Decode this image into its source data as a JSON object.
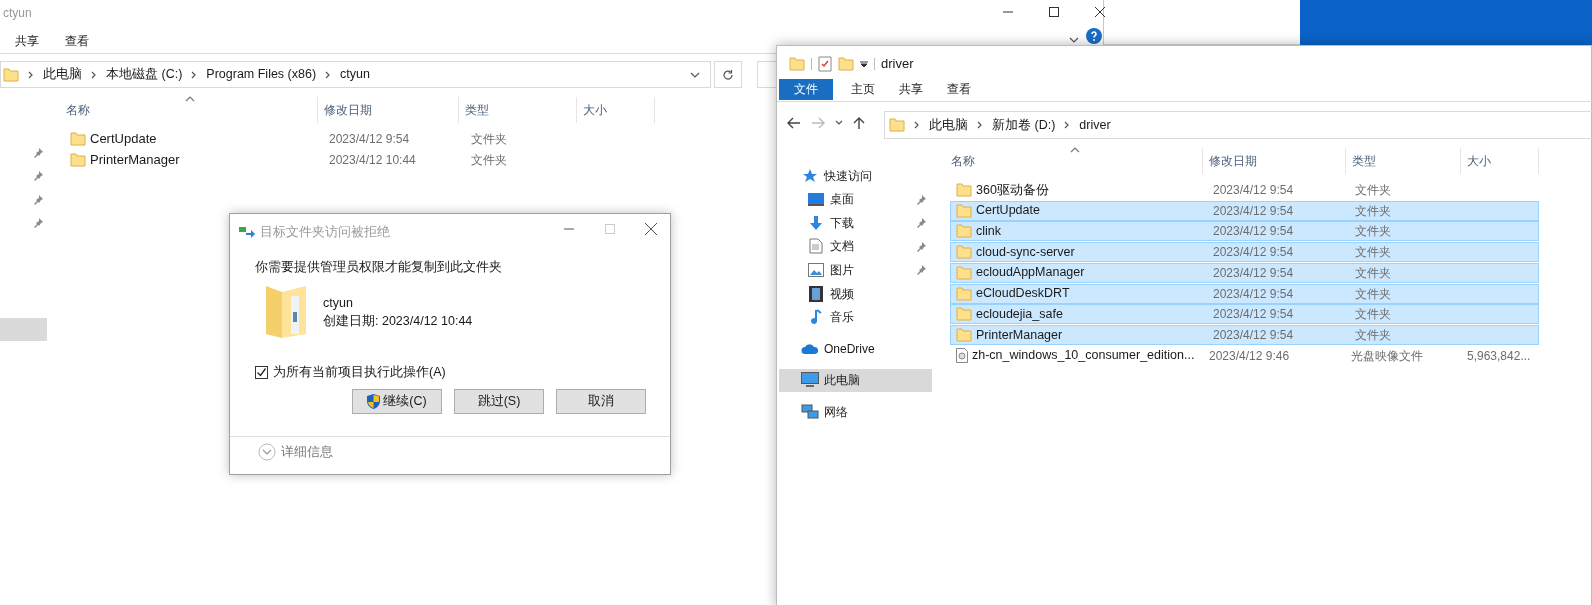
{
  "left_window": {
    "title": "ctyun",
    "ribbon_tabs": [
      {
        "label": "共享",
        "selected": false
      },
      {
        "label": "查看",
        "selected": false
      }
    ],
    "breadcrumb": [
      "此电脑",
      "本地磁盘 (C:)",
      "Program Files (x86)",
      "ctyun"
    ],
    "columns": [
      "名称",
      "修改日期",
      "类型",
      "大小"
    ],
    "rows": [
      {
        "name": "CertUpdate",
        "modified": "2023/4/12 9:54",
        "type": "文件夹"
      },
      {
        "name": "PrinterManager",
        "modified": "2023/4/12 10:44",
        "type": "文件夹"
      }
    ]
  },
  "dialog": {
    "title": "目标文件夹访问被拒绝",
    "message": "你需要提供管理员权限才能复制到此文件夹",
    "item_name": "ctyun",
    "item_detail": "创建日期: 2023/4/12 10:44",
    "apply_to_all": {
      "label": "为所有当前项目执行此操作(A)",
      "checked": true
    },
    "buttons": [
      {
        "label": "继续(C)",
        "kind": "shield"
      },
      {
        "label": "跳过(S)",
        "kind": "plain"
      },
      {
        "label": "取消",
        "kind": "plain"
      }
    ],
    "details_label": "详细信息"
  },
  "right_window": {
    "title": "driver",
    "ribbon_tabs": [
      {
        "label": "文件",
        "kind": "file_menu"
      },
      {
        "label": "主页",
        "kind": "tab"
      },
      {
        "label": "共享",
        "kind": "tab"
      },
      {
        "label": "查看",
        "kind": "tab"
      }
    ],
    "breadcrumb": [
      "此电脑",
      "新加卷 (D:)",
      "driver"
    ],
    "nav": [
      {
        "label": "快速访问",
        "kind": "star",
        "pinned": false,
        "selected": false,
        "indent": false
      },
      {
        "label": "桌面",
        "kind": "desktop",
        "pinned": true,
        "selected": false,
        "indent": true
      },
      {
        "label": "下载",
        "kind": "download",
        "pinned": true,
        "selected": false,
        "indent": true
      },
      {
        "label": "文档",
        "kind": "document",
        "pinned": true,
        "selected": false,
        "indent": true
      },
      {
        "label": "图片",
        "kind": "pictures",
        "pinned": true,
        "selected": false,
        "indent": true
      },
      {
        "label": "视频",
        "kind": "video",
        "pinned": false,
        "selected": false,
        "indent": true
      },
      {
        "label": "音乐",
        "kind": "music",
        "pinned": false,
        "selected": false,
        "indent": true
      },
      {
        "label": "OneDrive",
        "kind": "cloud",
        "pinned": false,
        "selected": false,
        "indent": false
      },
      {
        "label": "此电脑",
        "kind": "computer",
        "pinned": false,
        "selected": true,
        "indent": false
      },
      {
        "label": "网络",
        "kind": "network",
        "pinned": false,
        "selected": false,
        "indent": false
      }
    ],
    "columns": [
      "名称",
      "修改日期",
      "类型",
      "大小"
    ],
    "rows": [
      {
        "name": "360驱动备份",
        "modified": "2023/4/12 9:54",
        "type": "文件夹",
        "kind": "folder",
        "selected": false
      },
      {
        "name": "CertUpdate",
        "modified": "2023/4/12 9:54",
        "type": "文件夹",
        "kind": "folder",
        "selected": true
      },
      {
        "name": "clink",
        "modified": "2023/4/12 9:54",
        "type": "文件夹",
        "kind": "folder",
        "selected": true
      },
      {
        "name": "cloud-sync-server",
        "modified": "2023/4/12 9:54",
        "type": "文件夹",
        "kind": "folder",
        "selected": true
      },
      {
        "name": "ecloudAppManager",
        "modified": "2023/4/12 9:54",
        "type": "文件夹",
        "kind": "folder",
        "selected": true
      },
      {
        "name": "eCloudDeskDRT",
        "modified": "2023/4/12 9:54",
        "type": "文件夹",
        "kind": "folder",
        "selected": true
      },
      {
        "name": "ecloudejia_safe",
        "modified": "2023/4/12 9:54",
        "type": "文件夹",
        "kind": "folder",
        "selected": true
      },
      {
        "name": "PrinterManager",
        "modified": "2023/4/12 9:54",
        "type": "文件夹",
        "kind": "folder",
        "selected": true
      },
      {
        "name": "zh-cn_windows_10_consumer_edition...",
        "modified": "2023/4/12 9:46",
        "type": "光盘映像文件",
        "size": "5,963,842...",
        "kind": "disc",
        "selected": false
      }
    ]
  }
}
